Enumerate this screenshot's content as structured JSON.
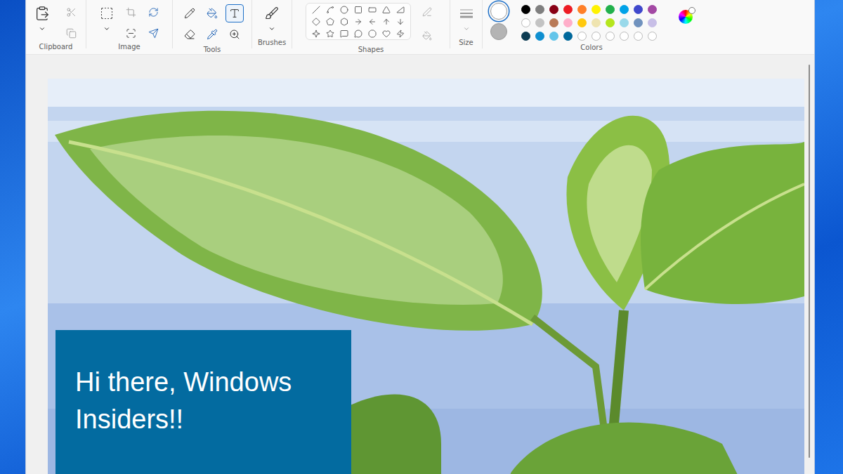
{
  "ribbon": {
    "groups": [
      {
        "label": "Clipboard"
      },
      {
        "label": "Image"
      },
      {
        "label": "Tools"
      },
      {
        "label": "Brushes"
      },
      {
        "label": "Shapes"
      },
      {
        "label": "Size"
      },
      {
        "label": "Colors"
      }
    ]
  },
  "tools": [
    {
      "selected": false
    },
    {
      "selected": false
    },
    {
      "selected": true
    },
    {
      "selected": false
    },
    {
      "selected": false
    },
    {
      "selected": false
    }
  ],
  "colors": {
    "primary": {
      "color": "#ffffff",
      "selected": true
    },
    "secondary": {
      "color": "#b4b4b4",
      "selected": false
    },
    "palette": [
      {
        "color": "#000000",
        "empty": false
      },
      {
        "color": "#7f7f7f",
        "empty": false
      },
      {
        "color": "#880015",
        "empty": false
      },
      {
        "color": "#ed1c24",
        "empty": false
      },
      {
        "color": "#ff7f27",
        "empty": false
      },
      {
        "color": "#fff200",
        "empty": false
      },
      {
        "color": "#22b14c",
        "empty": false
      },
      {
        "color": "#00a2e8",
        "empty": false
      },
      {
        "color": "#3f48cc",
        "empty": false
      },
      {
        "color": "#a349a4",
        "empty": false
      },
      {
        "color": "#ffffff",
        "empty": false
      },
      {
        "color": "#c3c3c3",
        "empty": false
      },
      {
        "color": "#b97a57",
        "empty": false
      },
      {
        "color": "#ffaec9",
        "empty": false
      },
      {
        "color": "#ffc90e",
        "empty": false
      },
      {
        "color": "#efe4b0",
        "empty": false
      },
      {
        "color": "#b5e61d",
        "empty": false
      },
      {
        "color": "#99d9ea",
        "empty": false
      },
      {
        "color": "#7092be",
        "empty": false
      },
      {
        "color": "#c8bfe7",
        "empty": false
      },
      {
        "color": "#0c3b52",
        "empty": false
      },
      {
        "color": "#0f8fd0",
        "empty": false
      },
      {
        "color": "#63c5ea",
        "empty": false
      },
      {
        "color": "#00689b",
        "empty": false
      },
      {
        "color": "#ffffff",
        "empty": true
      },
      {
        "color": "#ffffff",
        "empty": true
      },
      {
        "color": "#ffffff",
        "empty": true
      },
      {
        "color": "#ffffff",
        "empty": true
      },
      {
        "color": "#ffffff",
        "empty": true
      },
      {
        "color": "#ffffff",
        "empty": true
      }
    ]
  },
  "canvas": {
    "text_box": {
      "lines": [
        "Hi there, Windows",
        "Insiders!!"
      ]
    }
  }
}
